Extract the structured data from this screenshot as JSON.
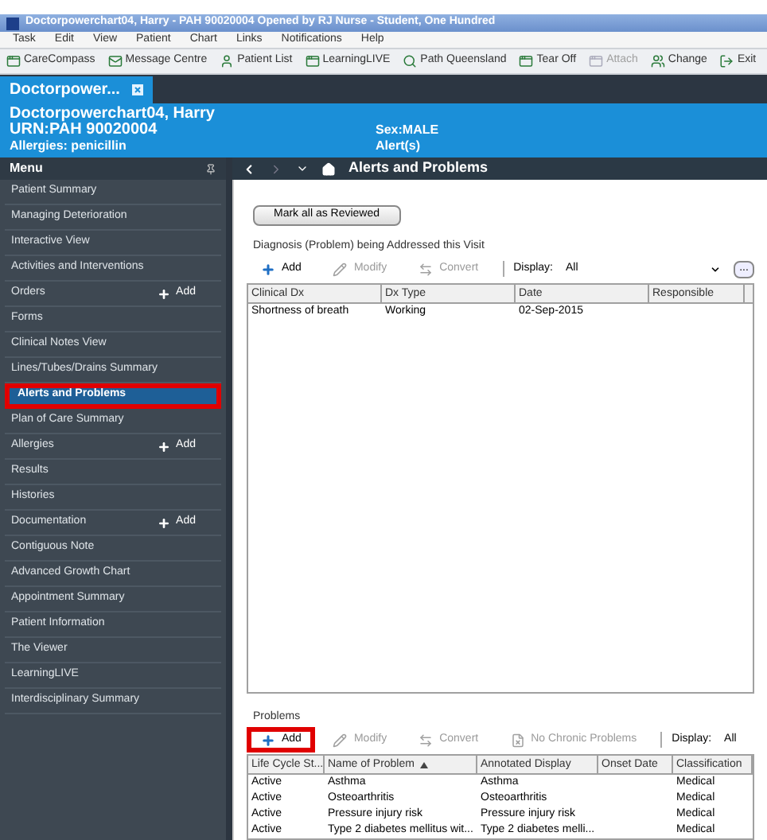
{
  "window": {
    "title": "Doctorpowerchart04, Harry - PAH 90020004  Opened by RJ Nurse - Student, One Hundred"
  },
  "menu_bar": [
    "Task",
    "Edit",
    "View",
    "Patient",
    "Chart",
    "Links",
    "Notifications",
    "Help"
  ],
  "toolbar": [
    {
      "label": "CareCompass",
      "kind": "app",
      "disabled": false
    },
    {
      "label": "Message Centre",
      "kind": "mail",
      "disabled": false
    },
    {
      "label": "Patient List",
      "kind": "person",
      "disabled": false
    },
    {
      "label": "LearningLIVE",
      "kind": "app",
      "disabled": false
    },
    {
      "label": "Path Queensland",
      "kind": "search",
      "disabled": false
    },
    {
      "label": "Tear Off",
      "kind": "window",
      "disabled": false
    },
    {
      "label": "Attach",
      "kind": "window",
      "disabled": true
    },
    {
      "label": "Change",
      "kind": "people",
      "disabled": false
    },
    {
      "label": "Exit",
      "kind": "exit",
      "disabled": false
    }
  ],
  "tabs": [
    {
      "label": "Doctorpower...",
      "selected": true
    }
  ],
  "banner": {
    "name": "Doctorpowerchart04, Harry",
    "urn": "URN:PAH 90020004",
    "allergies": "Allergies: penicillin",
    "sex": "Sex:MALE",
    "alerts": "Alert(s)"
  },
  "sidebar": {
    "title": "Menu",
    "items": [
      {
        "label": "Patient Summary",
        "selected": false
      },
      {
        "label": "Managing Deterioration",
        "selected": false
      },
      {
        "label": "Interactive View",
        "selected": false
      },
      {
        "label": "Activities and Interventions",
        "selected": false
      },
      {
        "label": "Orders",
        "selected": false,
        "action": "Add"
      },
      {
        "label": "Forms",
        "selected": false
      },
      {
        "label": "Clinical Notes View",
        "selected": false
      },
      {
        "label": "Lines/Tubes/Drains Summary",
        "selected": false
      },
      {
        "label": "Alerts and Problems",
        "selected": true
      },
      {
        "label": "Plan of Care Summary",
        "selected": false
      },
      {
        "label": "Allergies",
        "selected": false,
        "action": "Add"
      },
      {
        "label": "Results",
        "selected": false
      },
      {
        "label": "Histories",
        "selected": false
      },
      {
        "label": "Documentation",
        "selected": false,
        "action": "Add"
      },
      {
        "label": "Contiguous Note",
        "selected": false
      },
      {
        "label": "Advanced Growth Chart",
        "selected": false
      },
      {
        "label": "Appointment Summary",
        "selected": false
      },
      {
        "label": "Patient Information",
        "selected": false
      },
      {
        "label": "The Viewer",
        "selected": false
      },
      {
        "label": "LearningLIVE",
        "selected": false
      },
      {
        "label": "Interdisciplinary Summary",
        "selected": false
      }
    ]
  },
  "page_title": "Alerts and Problems",
  "mark_button": "Mark all as Reviewed",
  "diagnosis": {
    "title": "Diagnosis (Problem) being Addressed this Visit",
    "toolbar": [
      {
        "label": "Add",
        "kind": "add",
        "disabled": false,
        "highlighted": false
      },
      {
        "label": "Modify",
        "kind": "modify",
        "disabled": true,
        "highlighted": false
      },
      {
        "label": "Convert",
        "kind": "convert",
        "disabled": true,
        "highlighted": false
      }
    ],
    "display_label": "Display:",
    "display_value": "All",
    "more": "...",
    "columns": [
      "Clinical Dx",
      "Dx Type",
      "Date",
      "Responsible"
    ],
    "rows": [
      [
        "Shortness of breath",
        "Working",
        "02-Sep-2015",
        ""
      ]
    ]
  },
  "problems": {
    "title": "Problems",
    "toolbar": [
      {
        "label": "Add",
        "kind": "add",
        "disabled": false,
        "highlighted": true
      },
      {
        "label": "Modify",
        "kind": "modify",
        "disabled": true,
        "highlighted": false
      },
      {
        "label": "Convert",
        "kind": "convert",
        "disabled": true,
        "highlighted": false
      },
      {
        "label": "No Chronic Problems",
        "kind": "chronic",
        "disabled": true,
        "highlighted": false
      }
    ],
    "display_label": "Display:",
    "display_value": "All",
    "columns": [
      "Life Cycle St...",
      "Name of Problem",
      "Annotated Display",
      "Onset Date",
      "Classification"
    ],
    "rows": [
      [
        "Active",
        "Asthma",
        "Asthma",
        "",
        "Medical"
      ],
      [
        "Active",
        "Osteoarthritis",
        "Osteoarthritis",
        "",
        "Medical"
      ],
      [
        "Active",
        "Pressure injury risk",
        "Pressure injury risk",
        "",
        "Medical"
      ],
      [
        "Active",
        "Type 2 diabetes mellitus wit...",
        "Type 2 diabetes melli...",
        "",
        "Medical"
      ]
    ]
  }
}
